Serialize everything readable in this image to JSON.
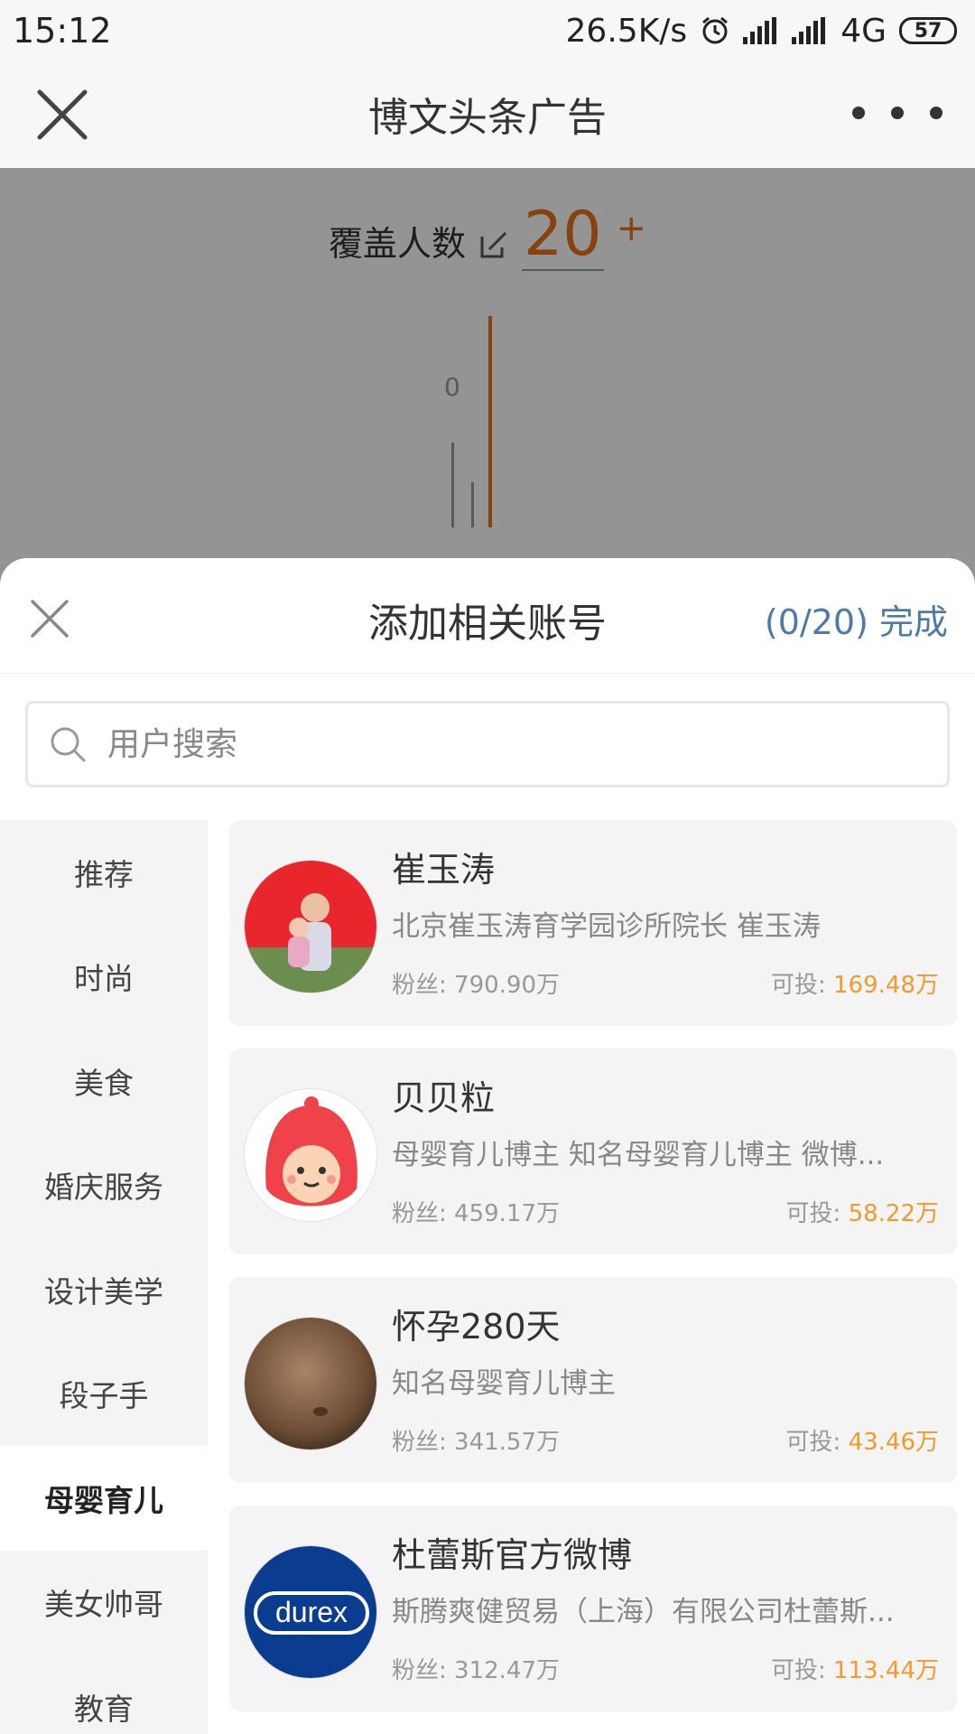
{
  "status_bar": {
    "time": "15:12",
    "net_speed": "26.5K/s",
    "network": "4G",
    "battery": "57"
  },
  "app_bar": {
    "title": "博文头条广告"
  },
  "background": {
    "coverage_label": "覆盖人数",
    "coverage_value": "20",
    "coverage_plus": "+",
    "chart_zero": "0"
  },
  "sheet": {
    "title": "添加相关账号",
    "count": "(0/20)",
    "done_label": "完成",
    "search_placeholder": "用户搜索"
  },
  "categories": [
    {
      "label": "推荐",
      "active": false
    },
    {
      "label": "时尚",
      "active": false
    },
    {
      "label": "美食",
      "active": false
    },
    {
      "label": "婚庆服务",
      "active": false
    },
    {
      "label": "设计美学",
      "active": false
    },
    {
      "label": "段子手",
      "active": false
    },
    {
      "label": "母婴育儿",
      "active": true
    },
    {
      "label": "美女帅哥",
      "active": false
    },
    {
      "label": "教育",
      "active": false
    }
  ],
  "accounts": [
    {
      "name": "崔玉涛",
      "desc": "北京崔玉涛育学园诊所院长 崔玉涛",
      "fans_label": "粉丝:",
      "fans": "790.90万",
      "budget_label": "可投:",
      "budget": "169.48万",
      "avatar_icon": "person-photo-avatar"
    },
    {
      "name": "贝贝粒",
      "desc": "母婴育儿博主 知名母婴育儿博主 微博...",
      "fans_label": "粉丝:",
      "fans": "459.17万",
      "budget_label": "可投:",
      "budget": "58.22万",
      "avatar_icon": "cartoon-baby-avatar"
    },
    {
      "name": "怀孕280天",
      "desc": "知名母婴育儿博主",
      "fans_label": "粉丝:",
      "fans": "341.57万",
      "budget_label": "可投:",
      "budget": "43.46万",
      "avatar_icon": "pregnant-belly-avatar"
    },
    {
      "name": "杜蕾斯官方微博",
      "desc": "斯腾爽健贸易（上海）有限公司杜蕾斯...",
      "fans_label": "粉丝:",
      "fans": "312.47万",
      "budget_label": "可投:",
      "budget": "113.44万",
      "avatar_icon": "durex-logo-avatar",
      "logo_text": "durex"
    }
  ],
  "colors": {
    "accent_orange": "#f39a2c",
    "link_blue": "#4e7ba6"
  }
}
